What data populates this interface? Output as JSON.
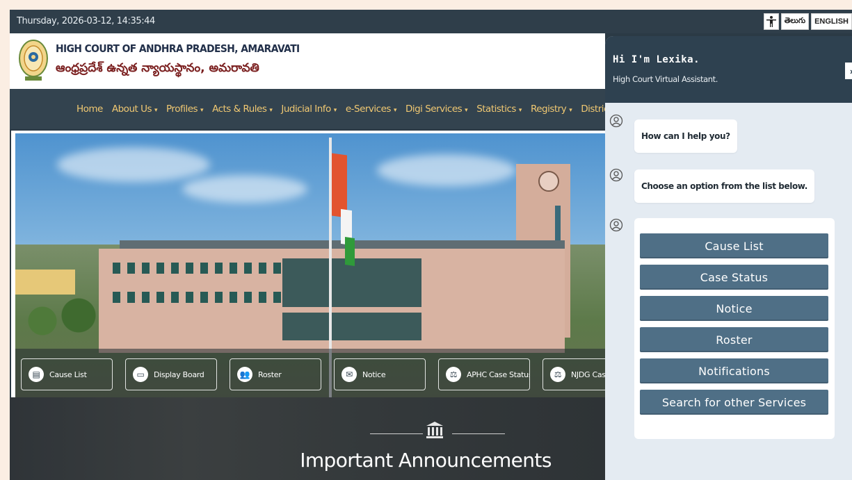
{
  "topbar": {
    "datetime": "Thursday, 2026-03-12, 14:35:44",
    "language_telugu": "తెలుగు",
    "language_english": "ENGLISH",
    "accessibility_icon": "accessibility-icon"
  },
  "header": {
    "court_name_en": "HIGH COURT OF ANDHRA PRADESH, AMARAVATI",
    "court_name_te": "ఆంధ్రప్రదేశ్ ఉన్నత న్యాయస్థానం, అమరావతి",
    "logo_icon": "emblem-logo"
  },
  "nav": {
    "items": [
      {
        "label": "Home",
        "dropdown": false
      },
      {
        "label": "About Us",
        "dropdown": true
      },
      {
        "label": "Profiles",
        "dropdown": true
      },
      {
        "label": "Acts & Rules",
        "dropdown": true
      },
      {
        "label": "Judicial Info",
        "dropdown": true
      },
      {
        "label": "e-Services",
        "dropdown": true
      },
      {
        "label": "Digi Services",
        "dropdown": true
      },
      {
        "label": "Statistics",
        "dropdown": true
      },
      {
        "label": "Registry",
        "dropdown": true
      },
      {
        "label": "District",
        "dropdown": false
      }
    ]
  },
  "quick_links": [
    {
      "label": "Cause List",
      "icon": "document-icon"
    },
    {
      "label": "Display Board",
      "icon": "monitor-icon"
    },
    {
      "label": "Roster",
      "icon": "people-icon"
    },
    {
      "label": "Notice",
      "icon": "envelope-icon"
    },
    {
      "label": "APHC Case Status",
      "icon": "scales-icon"
    },
    {
      "label": "NJDG Case",
      "icon": "scales-icon"
    }
  ],
  "announcements": {
    "title": "Important Announcements",
    "icon": "courthouse-icon"
  },
  "chatbot": {
    "title": "Hi I'm Lexika.",
    "subtitle": "High Court Virtual Assistant.",
    "close_icon": "close-icon",
    "avatar_icon": "user-avatar-icon",
    "messages": [
      "How can I help you?",
      "Choose an option from the list below."
    ],
    "options": [
      "Cause List",
      "Case Status",
      "Notice",
      "Roster",
      "Notifications",
      "Search for other Services"
    ]
  },
  "colors": {
    "nav_text": "#f0c872",
    "dark_panel": "#2e4150",
    "option_button": "#4f6f86",
    "court_name_te": "#7a1e1e"
  }
}
